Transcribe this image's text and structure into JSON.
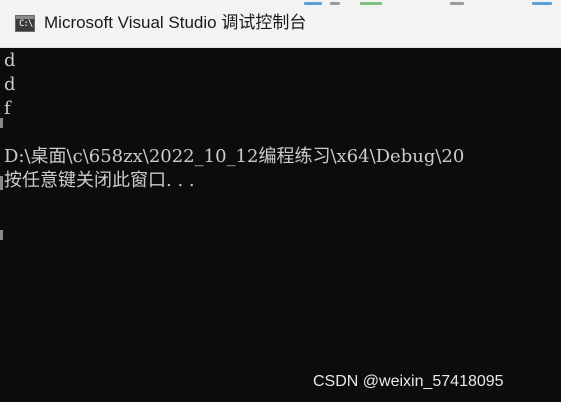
{
  "window": {
    "title": "Microsoft Visual Studio 调试控制台",
    "icon_glyph": "C:\\",
    "icon_name": "console-app-icon"
  },
  "console": {
    "lines": [
      "d",
      "d",
      "f",
      "",
      "D:\\桌面\\c\\658zx\\2022_10_12编程练习\\x64\\Debug\\20",
      "按任意键关闭此窗口. . ."
    ]
  },
  "watermark": "CSDN @weixin_57418095",
  "colors": {
    "titlebar_bg": "#f3f3f3",
    "console_bg": "#0c0c0c",
    "console_text": "#cccccc"
  }
}
